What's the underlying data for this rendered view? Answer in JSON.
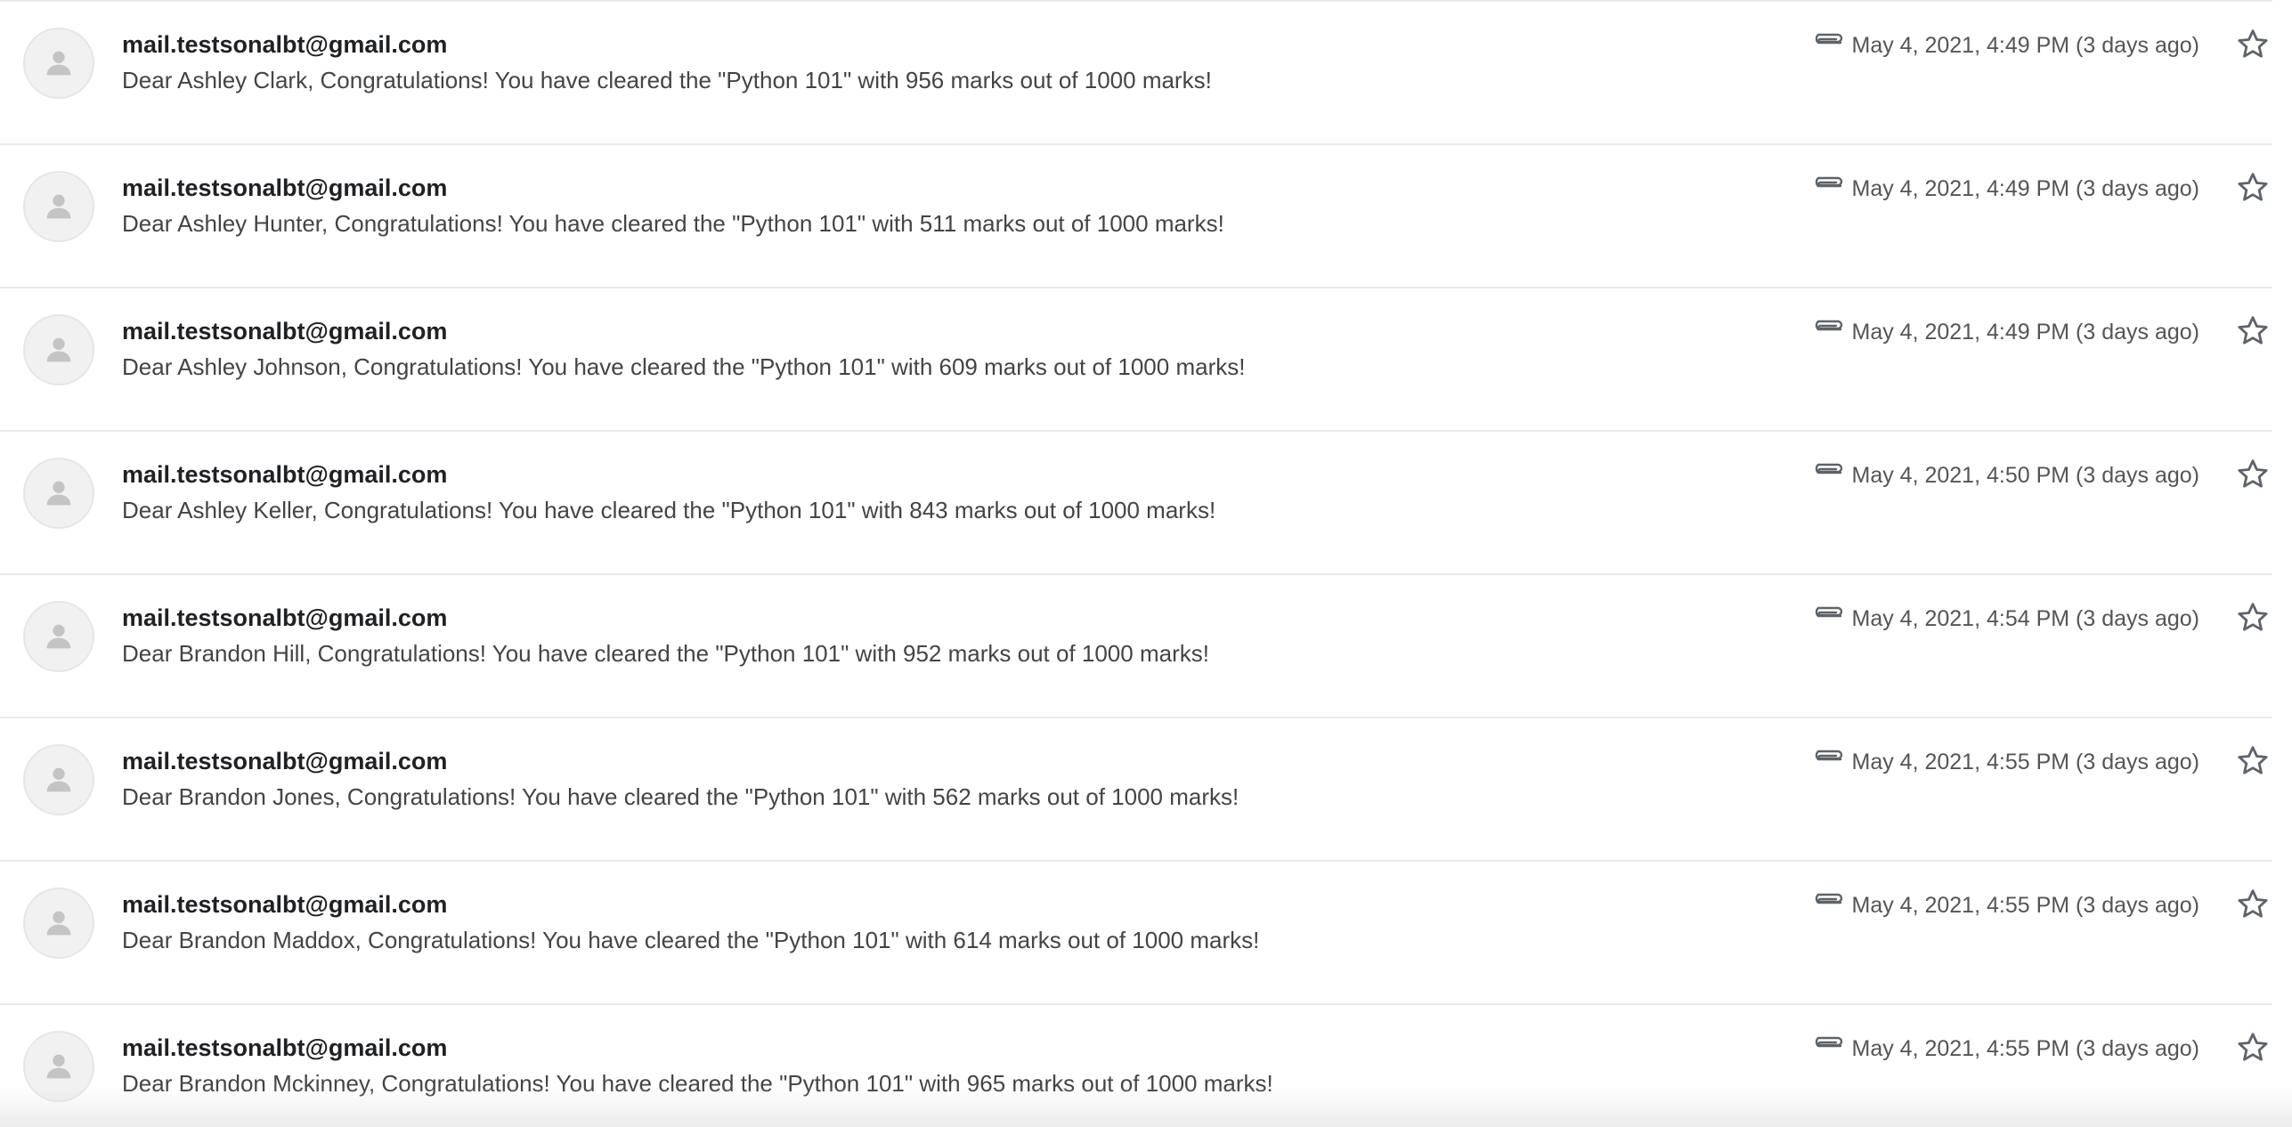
{
  "threads": [
    {
      "sender": "mail.testsonalbt@gmail.com",
      "snippet": "Dear Ashley Clark, Congratulations! You have cleared the \"Python 101\" with 956 marks out of 1000 marks!",
      "date": "May 4, 2021, 4:49 PM (3 days ago)",
      "has_attachment": true,
      "starred": false
    },
    {
      "sender": "mail.testsonalbt@gmail.com",
      "snippet": "Dear Ashley Hunter, Congratulations! You have cleared the \"Python 101\" with 511 marks out of 1000 marks!",
      "date": "May 4, 2021, 4:49 PM (3 days ago)",
      "has_attachment": true,
      "starred": false
    },
    {
      "sender": "mail.testsonalbt@gmail.com",
      "snippet": "Dear Ashley Johnson, Congratulations! You have cleared the \"Python 101\" with 609 marks out of 1000 marks!",
      "date": "May 4, 2021, 4:49 PM (3 days ago)",
      "has_attachment": true,
      "starred": false
    },
    {
      "sender": "mail.testsonalbt@gmail.com",
      "snippet": "Dear Ashley Keller, Congratulations! You have cleared the \"Python 101\" with 843 marks out of 1000 marks!",
      "date": "May 4, 2021, 4:50 PM (3 days ago)",
      "has_attachment": true,
      "starred": false
    },
    {
      "sender": "mail.testsonalbt@gmail.com",
      "snippet": "Dear Brandon Hill, Congratulations! You have cleared the \"Python 101\" with 952 marks out of 1000 marks!",
      "date": "May 4, 2021, 4:54 PM (3 days ago)",
      "has_attachment": true,
      "starred": false
    },
    {
      "sender": "mail.testsonalbt@gmail.com",
      "snippet": "Dear Brandon Jones, Congratulations! You have cleared the \"Python 101\" with 562 marks out of 1000 marks!",
      "date": "May 4, 2021, 4:55 PM (3 days ago)",
      "has_attachment": true,
      "starred": false
    },
    {
      "sender": "mail.testsonalbt@gmail.com",
      "snippet": "Dear Brandon Maddox, Congratulations! You have cleared the \"Python 101\" with 614 marks out of 1000 marks!",
      "date": "May 4, 2021, 4:55 PM (3 days ago)",
      "has_attachment": true,
      "starred": false
    },
    {
      "sender": "mail.testsonalbt@gmail.com",
      "snippet": "Dear Brandon Mckinney, Congratulations! You have cleared the \"Python 101\" with 965 marks out of 1000 marks!",
      "date": "May 4, 2021, 4:55 PM (3 days ago)",
      "has_attachment": true,
      "starred": false
    }
  ],
  "icons": {
    "avatar": "person-icon",
    "attachment": "paperclip-icon",
    "star": "star-outline-icon"
  },
  "colors": {
    "avatar_bg": "#f1f1f1",
    "avatar_glyph": "#c4c4c4",
    "sender_text": "#202124",
    "snippet_text": "#444444",
    "date_text": "#555555",
    "icon_stroke": "#5f6368"
  }
}
